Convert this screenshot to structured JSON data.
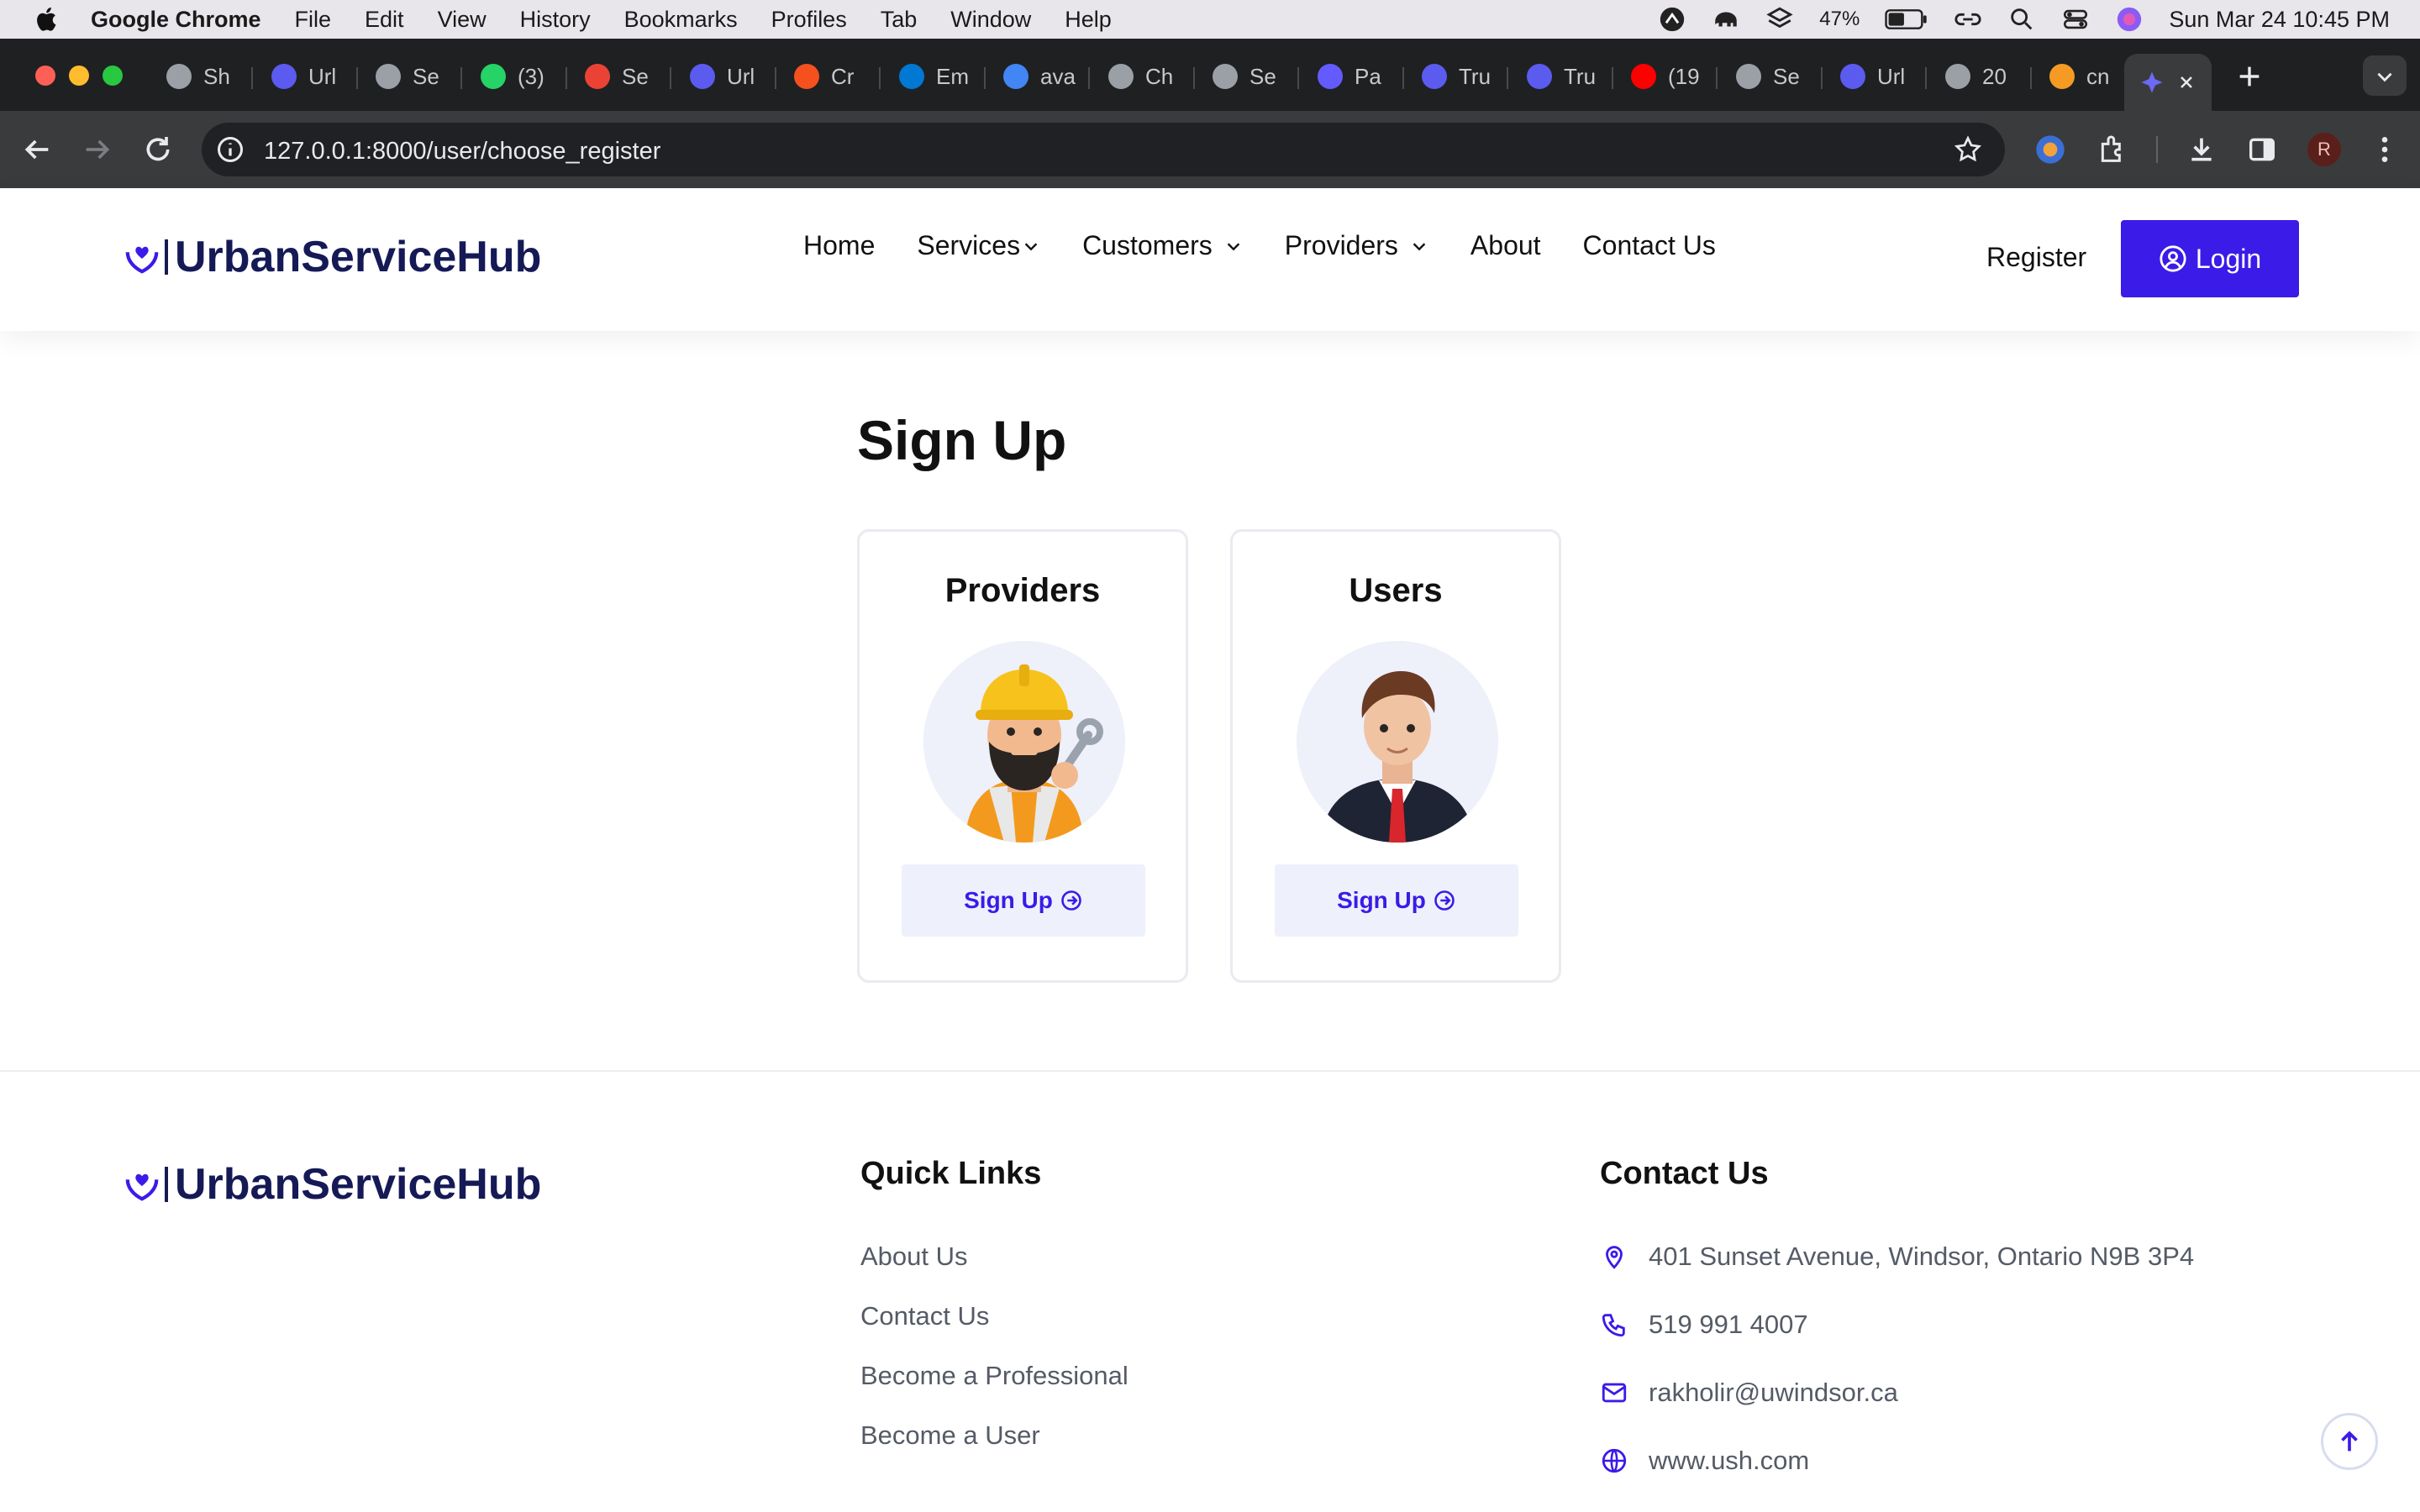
{
  "os_menubar": {
    "app_name": "Google Chrome",
    "menus": [
      "File",
      "Edit",
      "View",
      "History",
      "Bookmarks",
      "Profiles",
      "Tab",
      "Window",
      "Help"
    ],
    "battery": "47%",
    "datetime": "Sun Mar 24  10:45 PM"
  },
  "browser": {
    "tabs": [
      {
        "label": "Sh",
        "icon": "chatgpt-icon",
        "color": "#9aa0a6"
      },
      {
        "label": "Url",
        "icon": "diamond-icon",
        "color": "#5b5bf0"
      },
      {
        "label": "Se",
        "icon": "globe-icon",
        "color": "#9aa0a6"
      },
      {
        "label": "(3)",
        "icon": "whatsapp-icon",
        "color": "#25d366"
      },
      {
        "label": "Se",
        "icon": "gmail-icon",
        "color": "#ea4335"
      },
      {
        "label": "Url",
        "icon": "diamond-icon",
        "color": "#5b5bf0"
      },
      {
        "label": "Cr",
        "icon": "app-icon",
        "color": "#f4511e"
      },
      {
        "label": "Em",
        "icon": "outlook-icon",
        "color": "#0078d4"
      },
      {
        "label": "ava",
        "icon": "google-icon",
        "color": "#4285f4"
      },
      {
        "label": "Ch",
        "icon": "chatgpt-icon",
        "color": "#9aa0a6"
      },
      {
        "label": "Se",
        "icon": "globe-icon",
        "color": "#9aa0a6"
      },
      {
        "label": "Pa",
        "icon": "stripe-icon",
        "color": "#635bff"
      },
      {
        "label": "Tru",
        "icon": "diamond-icon",
        "color": "#5b5bf0"
      },
      {
        "label": "Tru",
        "icon": "diamond-icon",
        "color": "#5b5bf0"
      },
      {
        "label": "(19",
        "icon": "youtube-icon",
        "color": "#ff0000"
      },
      {
        "label": "Se",
        "icon": "globe-icon",
        "color": "#9aa0a6"
      },
      {
        "label": "Url",
        "icon": "diamond-icon",
        "color": "#5b5bf0"
      },
      {
        "label": "20",
        "icon": "globe-icon",
        "color": "#9aa0a6"
      },
      {
        "label": "cn",
        "icon": "app-icon",
        "color": "#f59b23"
      }
    ],
    "url": "127.0.0.1:8000/user/choose_register",
    "profile_initial": "R"
  },
  "site": {
    "brand": "UrbanServiceHub",
    "nav": {
      "home": "Home",
      "services": "Services",
      "customers": "Customers",
      "providers": "Providers",
      "about": "About",
      "contact": "Contact Us"
    },
    "register": "Register",
    "login": "Login",
    "accent": "#3b1be8"
  },
  "main": {
    "heading": "Sign Up",
    "cards": [
      {
        "title": "Providers",
        "button": "Sign Up"
      },
      {
        "title": "Users",
        "button": "Sign Up"
      }
    ]
  },
  "footer": {
    "quick_links_title": "Quick Links",
    "quick_links": [
      "About Us",
      "Contact Us",
      "Become a Professional",
      "Become a User"
    ],
    "contact_title": "Contact Us",
    "address": "401 Sunset Avenue, Windsor, Ontario N9B 3P4",
    "phone": "519 991 4007",
    "email": "rakholir@uwindsor.ca",
    "website": "www.ush.com"
  }
}
